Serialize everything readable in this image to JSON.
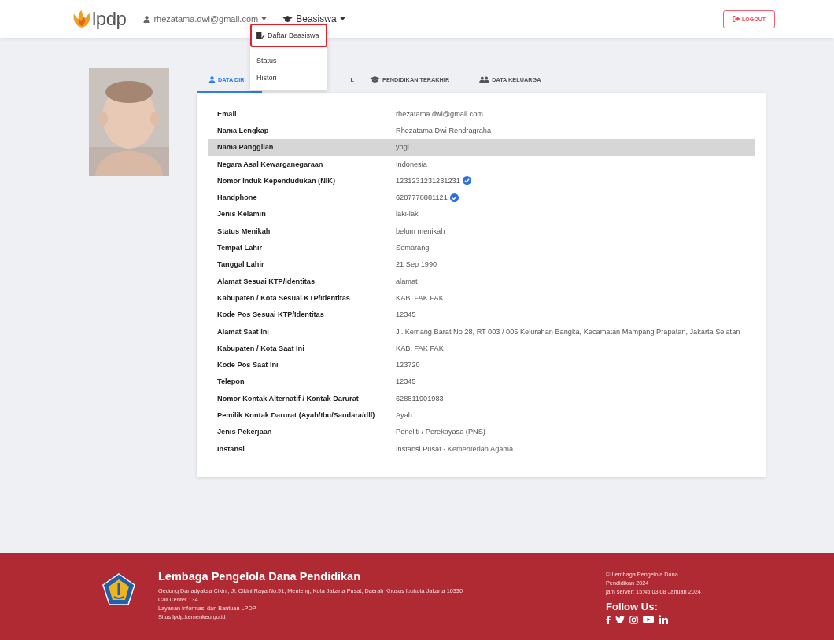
{
  "header": {
    "logo_text": "lpdp",
    "user_menu": "rhezatama.dwi@gmail.com",
    "menu": "Beasiswa",
    "logout": "LOGOUT"
  },
  "dropdown": [
    {
      "label": "Daftar Beasiswa",
      "highlighted": true
    },
    {
      "label": "Status",
      "highlighted": false
    },
    {
      "label": "Histori",
      "highlighted": false
    }
  ],
  "profile": {
    "tabs": [
      {
        "label": "DATA DIRI",
        "selected": true
      },
      {
        "label": "L",
        "selected": false
      },
      {
        "label": "PENDIDIKAN TERAKHIR",
        "selected": false
      },
      {
        "label": "DATA KELUARGA",
        "selected": false
      }
    ],
    "rows": [
      {
        "label": "Email",
        "value": "rhezatama.dwi@gmail.com",
        "verified": false,
        "highlighted": false
      },
      {
        "label": "Nama Lengkap",
        "value": "Rhezatama Dwi Rendragraha",
        "verified": false,
        "highlighted": false
      },
      {
        "label": "Nama Panggilan",
        "value": "yogi",
        "verified": false,
        "highlighted": true
      },
      {
        "label": "Negara Asal Kewarganegaraan",
        "value": "Indonesia",
        "verified": false,
        "highlighted": false
      },
      {
        "label": "Nomor Induk Kependudukan (NIK)",
        "value": "1231231231231231",
        "verified": true,
        "highlighted": false
      },
      {
        "label": "Handphone",
        "value": "6287778881121",
        "verified": true,
        "highlighted": false
      },
      {
        "label": "Jenis Kelamin",
        "value": "laki-laki",
        "verified": false,
        "highlighted": false
      },
      {
        "label": "Status Menikah",
        "value": "belum menikah",
        "verified": false,
        "highlighted": false
      },
      {
        "label": "Tempat Lahir",
        "value": "Semarang",
        "verified": false,
        "highlighted": false
      },
      {
        "label": "Tanggal Lahir",
        "value": "21 Sep 1990",
        "verified": false,
        "highlighted": false
      },
      {
        "label": "Alamat Sesuai KTP/Identitas",
        "value": "alamat",
        "verified": false,
        "highlighted": false
      },
      {
        "label": "Kabupaten / Kota Sesuai KTP/Identitas",
        "value": "KAB. FAK FAK",
        "verified": false,
        "highlighted": false
      },
      {
        "label": "Kode Pos Sesuai KTP/Identitas",
        "value": "12345",
        "verified": false,
        "highlighted": false
      },
      {
        "label": "Alamat Saat Ini",
        "value": "Jl. Kemang Barat No 28, RT 003 / 005 Kelurahan Bangka, Kecamatan Mampang Prapatan, Jakarta Selatan",
        "verified": false,
        "highlighted": false
      },
      {
        "label": "Kabupaten / Kota Saat Ini",
        "value": "KAB. FAK FAK",
        "verified": false,
        "highlighted": false
      },
      {
        "label": "Kode Pos Saat Ini",
        "value": "123720",
        "verified": false,
        "highlighted": false
      },
      {
        "label": "Telepon",
        "value": "12345",
        "verified": false,
        "highlighted": false
      },
      {
        "label": "Nomor Kontak Alternatif / Kontak Darurat",
        "value": "628811901983",
        "verified": false,
        "highlighted": false
      },
      {
        "label": "Pemilik Kontak Darurat (Ayah/Ibu/Saudara/dll)",
        "value": "Ayah",
        "verified": false,
        "highlighted": false
      },
      {
        "label": "Jenis Pekerjaan",
        "value": "Peneliti / Perekayasa (PNS)",
        "verified": false,
        "highlighted": false
      },
      {
        "label": "Instansi",
        "value": "Instansi Pusat - Kementerian Agama",
        "verified": false,
        "highlighted": false
      }
    ]
  },
  "footer": {
    "title": "Lembaga Pengelola Dana Pendidikan",
    "lines": [
      "Gedung Danadyaksa Cikini, Jl. Cikini Raya No.91, Menteng, Kota Jakarta Pusat, Daerah Khusus Ibukota Jakarta 10330",
      "Call Center 134",
      "Layanan Informasi dan Bantuan LPDP",
      "Situs lpdp.kemenkeu.go.id"
    ],
    "copyright": [
      "© Lembaga Pengelola Dana",
      "Pendidikan 2024"
    ],
    "server_time": "jam server: 15:45:03 08 Januari 2024",
    "follow": "Follow Us:"
  }
}
